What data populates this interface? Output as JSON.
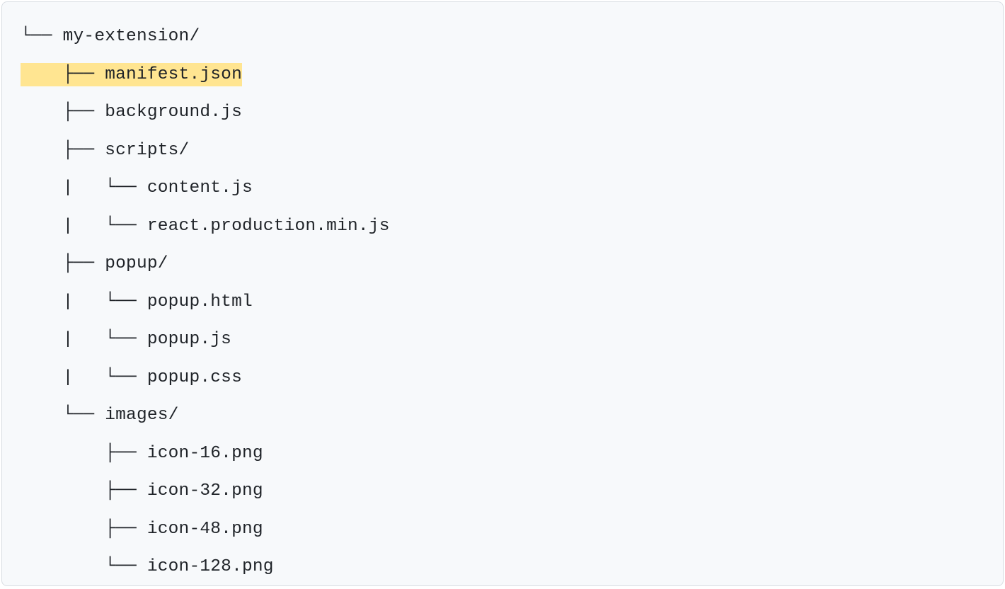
{
  "tree": {
    "lines": [
      {
        "prefix": "└── ",
        "name": "my-extension/",
        "highlighted": false
      },
      {
        "prefix": "    ├── ",
        "name": "manifest.json",
        "highlighted": true
      },
      {
        "prefix": "    ├── ",
        "name": "background.js",
        "highlighted": false
      },
      {
        "prefix": "    ├── ",
        "name": "scripts/",
        "highlighted": false
      },
      {
        "prefix": "    |   └── ",
        "name": "content.js",
        "highlighted": false
      },
      {
        "prefix": "    |   └── ",
        "name": "react.production.min.js",
        "highlighted": false
      },
      {
        "prefix": "    ├── ",
        "name": "popup/",
        "highlighted": false
      },
      {
        "prefix": "    |   └── ",
        "name": "popup.html",
        "highlighted": false
      },
      {
        "prefix": "    |   └── ",
        "name": "popup.js",
        "highlighted": false
      },
      {
        "prefix": "    |   └── ",
        "name": "popup.css",
        "highlighted": false
      },
      {
        "prefix": "    └── ",
        "name": "images/",
        "highlighted": false
      },
      {
        "prefix": "        ├── ",
        "name": "icon-16.png",
        "highlighted": false
      },
      {
        "prefix": "        ├── ",
        "name": "icon-32.png",
        "highlighted": false
      },
      {
        "prefix": "        ├── ",
        "name": "icon-48.png",
        "highlighted": false
      },
      {
        "prefix": "        └── ",
        "name": "icon-128.png",
        "highlighted": false
      }
    ]
  }
}
